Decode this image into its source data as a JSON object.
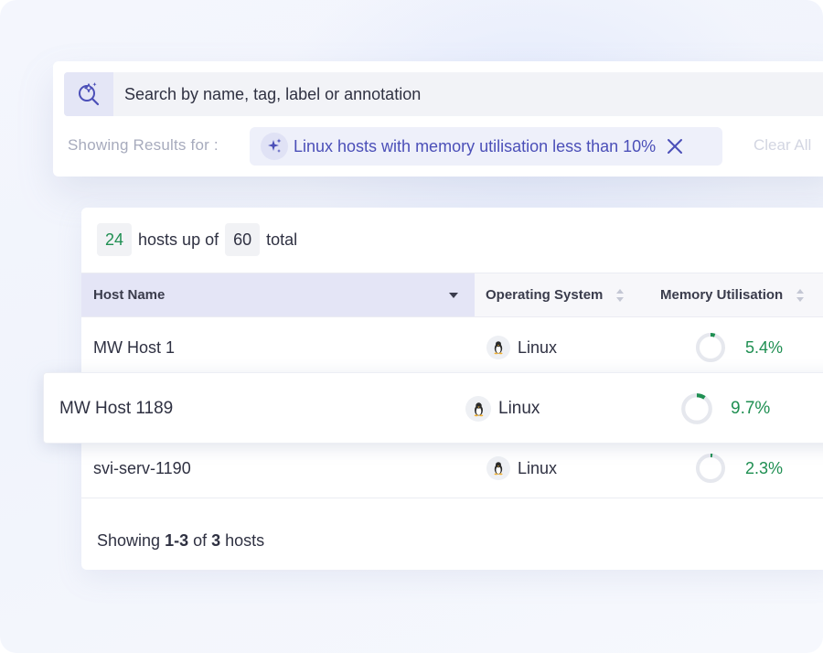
{
  "search": {
    "placeholder": "Search by name, tag, label or annotation",
    "results_label": "Showing Results for :",
    "chip_text": "Linux hosts with memory utilisation less than 10%",
    "clear_all": "Clear All"
  },
  "summary": {
    "up_count": "24",
    "up_text": "hosts up of",
    "total_count": "60",
    "total_text": "total"
  },
  "table": {
    "headers": {
      "host": "Host Name",
      "os": "Operating System",
      "memory": "Memory Utilisation"
    },
    "rows": [
      {
        "host": "MW Host 1",
        "os": "Linux",
        "memory_label": "5.4%",
        "memory_value": 5.4
      },
      {
        "host": "MW Host 1189",
        "os": "Linux",
        "memory_label": "9.7%",
        "memory_value": 9.7
      },
      {
        "host": "svi-serv-1190",
        "os": "Linux",
        "memory_label": "2.3%",
        "memory_value": 2.3
      }
    ]
  },
  "footer": {
    "prefix": "Showing",
    "range": "1-3",
    "of": "of",
    "count": "3",
    "suffix": "hosts"
  },
  "colors": {
    "accent": "#4b4fb8",
    "success": "#1f8f52",
    "ring_track": "#e6e8ee"
  },
  "icons": {
    "search": "sparkle-search-icon",
    "chip": "sparkles-icon",
    "close": "close-icon",
    "os": "linux-penguin-icon",
    "sort": "sort-icon"
  }
}
